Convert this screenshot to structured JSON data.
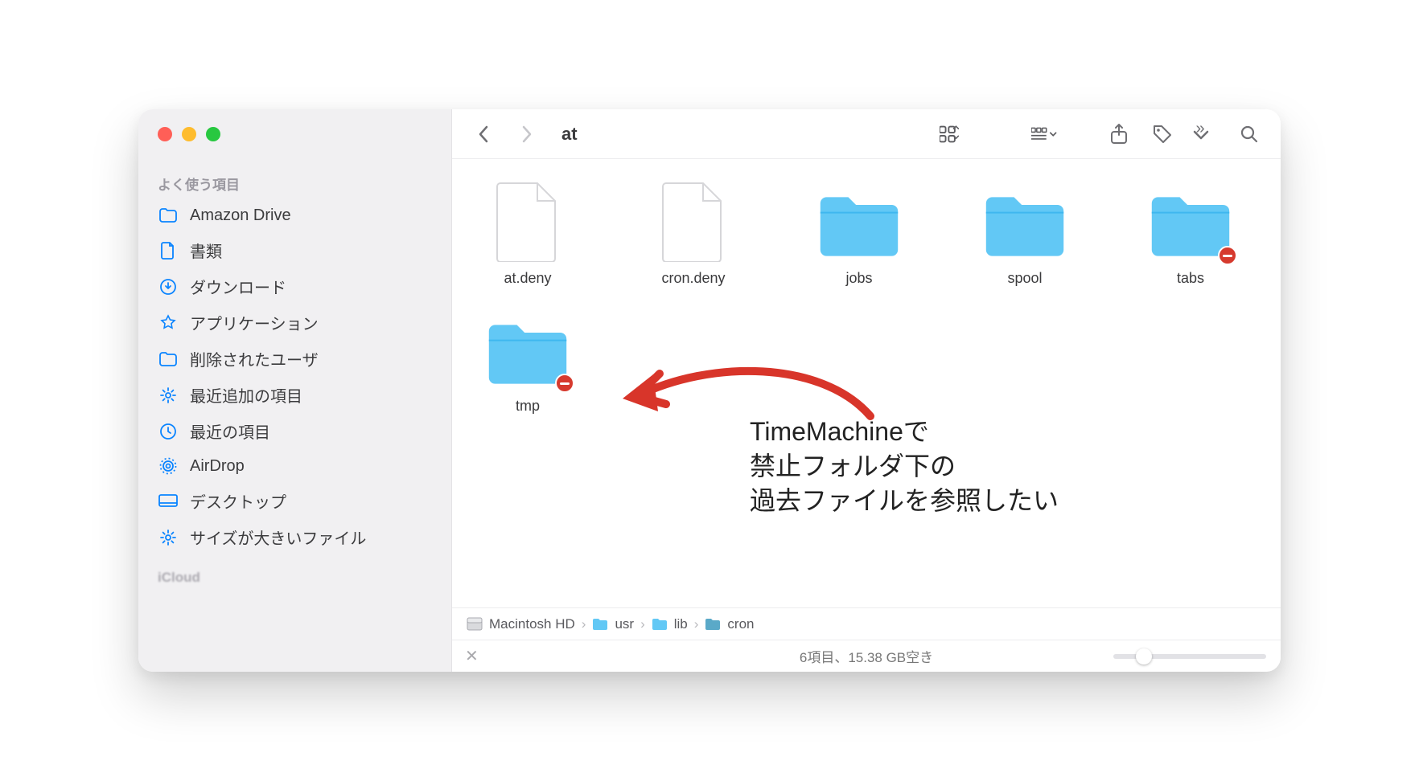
{
  "sidebar": {
    "section_label_favorites": "よく使う項目",
    "section_label_icloud": "iCloud",
    "items": [
      {
        "icon": "folder",
        "label": "Amazon Drive"
      },
      {
        "icon": "doc",
        "label": "書類"
      },
      {
        "icon": "download",
        "label": "ダウンロード"
      },
      {
        "icon": "app",
        "label": "アプリケーション"
      },
      {
        "icon": "folder",
        "label": "削除されたユーザ"
      },
      {
        "icon": "gear",
        "label": "最近追加の項目"
      },
      {
        "icon": "clock",
        "label": "最近の項目"
      },
      {
        "icon": "airdrop",
        "label": "AirDrop"
      },
      {
        "icon": "desktop",
        "label": "デスクトップ"
      },
      {
        "icon": "gear",
        "label": "サイズが大きいファイル"
      }
    ]
  },
  "toolbar": {
    "title": "at"
  },
  "items": [
    {
      "type": "file",
      "name": "at.deny",
      "restricted": false
    },
    {
      "type": "file",
      "name": "cron.deny",
      "restricted": false
    },
    {
      "type": "folder",
      "name": "jobs",
      "restricted": false
    },
    {
      "type": "folder",
      "name": "spool",
      "restricted": false
    },
    {
      "type": "folder",
      "name": "tabs",
      "restricted": true
    },
    {
      "type": "folder",
      "name": "tmp",
      "restricted": true
    }
  ],
  "annotation": {
    "line1": "TimeMachineで",
    "line2": "禁止フォルダ下の",
    "line3": "過去ファイルを参照したい"
  },
  "pathbar": {
    "segments": [
      {
        "icon": "disk",
        "label": "Macintosh HD"
      },
      {
        "icon": "folder",
        "label": "usr"
      },
      {
        "icon": "folder",
        "label": "lib"
      },
      {
        "icon": "folder-dark",
        "label": "cron"
      }
    ]
  },
  "statusbar": {
    "text": "6項目、15.38 GB空き"
  }
}
